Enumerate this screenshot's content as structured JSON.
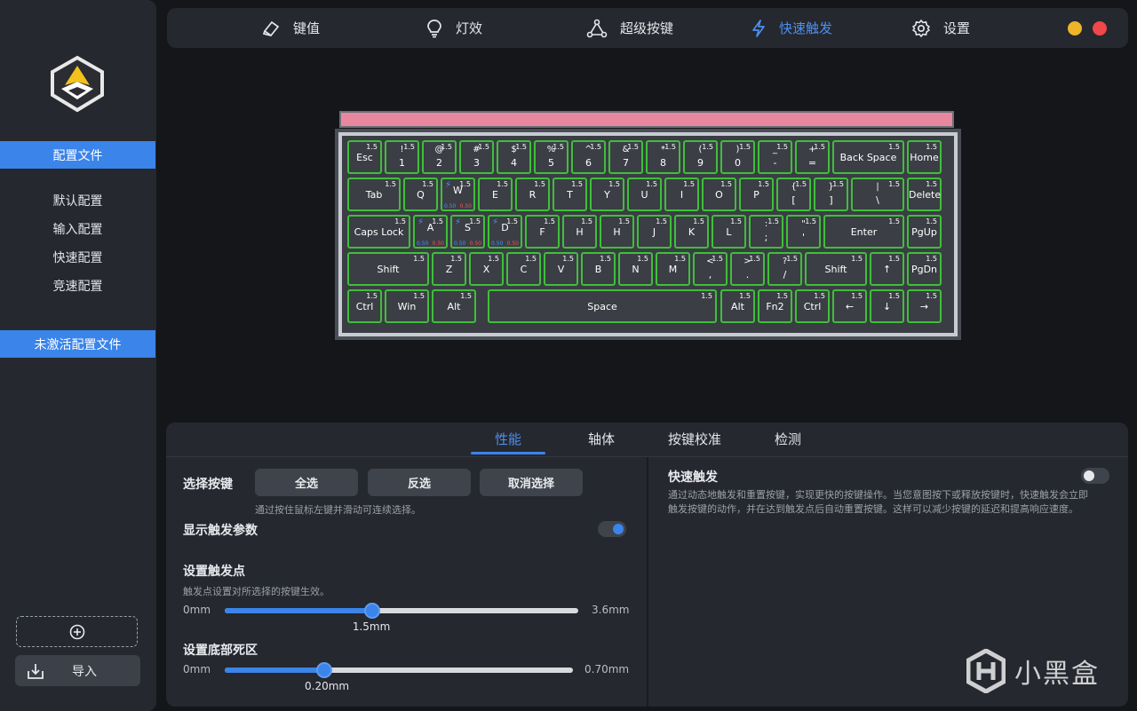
{
  "sidebar": {
    "profiles_header": "配置文件",
    "profiles": [
      "默认配置",
      "输入配置",
      "快速配置",
      "竞速配置"
    ],
    "inactive_header": "未激活配置文件",
    "import_label": "导入"
  },
  "nav": {
    "items": [
      {
        "label": "键值",
        "icon": "key-cap-icon"
      },
      {
        "label": "灯效",
        "icon": "lightbulb-icon"
      },
      {
        "label": "超级按键",
        "icon": "nodes-icon"
      },
      {
        "label": "快速触发",
        "icon": "lightning-icon",
        "active": true
      },
      {
        "label": "设置",
        "icon": "gear-icon"
      }
    ],
    "window_buttons": {
      "minimize_color": "#f0b429",
      "close_color": "#f0474a"
    }
  },
  "keyboard": {
    "strip_color": "#e8889f",
    "key_border_color": "#3fbf3a",
    "rows": [
      [
        {
          "lines": [
            "Esc"
          ],
          "t": "1.5"
        },
        {
          "lines": [
            "!",
            "1"
          ],
          "t": "1.5"
        },
        {
          "lines": [
            "@",
            "2"
          ],
          "t": "1.5"
        },
        {
          "lines": [
            "#",
            "3"
          ],
          "t": "1.5"
        },
        {
          "lines": [
            "$",
            "4"
          ],
          "t": "1.5"
        },
        {
          "lines": [
            "%",
            "5"
          ],
          "t": "1.5"
        },
        {
          "lines": [
            "^",
            "6"
          ],
          "t": "1.5"
        },
        {
          "lines": [
            "&",
            "7"
          ],
          "t": "1.5"
        },
        {
          "lines": [
            "*",
            "8"
          ],
          "t": "1.5"
        },
        {
          "lines": [
            "(",
            "9"
          ],
          "t": "1.5"
        },
        {
          "lines": [
            ")",
            "0"
          ],
          "t": "1.5"
        },
        {
          "lines": [
            "_",
            "-"
          ],
          "t": "1.5"
        },
        {
          "lines": [
            "+",
            "="
          ],
          "t": "1.5"
        },
        {
          "lines": [
            "Back Space"
          ],
          "t": "1.5"
        },
        {
          "lines": [
            "Home"
          ],
          "t": "1.5"
        }
      ],
      [
        {
          "lines": [
            "Tab"
          ],
          "t": "1.5"
        },
        {
          "lines": [
            "Q"
          ],
          "t": "1.5"
        },
        {
          "lines": [
            "W"
          ],
          "t": "1.5",
          "rt": true,
          "lo": "0.50",
          "hi": "0.50"
        },
        {
          "lines": [
            "E"
          ],
          "t": "1.5"
        },
        {
          "lines": [
            "R"
          ],
          "t": "1.5"
        },
        {
          "lines": [
            "T"
          ],
          "t": "1.5"
        },
        {
          "lines": [
            "Y"
          ],
          "t": "1.5"
        },
        {
          "lines": [
            "U"
          ],
          "t": "1.5"
        },
        {
          "lines": [
            "I"
          ],
          "t": "1.5"
        },
        {
          "lines": [
            "O"
          ],
          "t": "1.5"
        },
        {
          "lines": [
            "P"
          ],
          "t": "1.5"
        },
        {
          "lines": [
            "{",
            "["
          ],
          "t": "1.5"
        },
        {
          "lines": [
            "}",
            "]"
          ],
          "t": "1.5"
        },
        {
          "lines": [
            "|",
            "\\"
          ],
          "t": "1.5"
        },
        {
          "lines": [
            "Delete"
          ],
          "t": "1.5"
        }
      ],
      [
        {
          "lines": [
            "Caps Lock"
          ],
          "t": "1.5"
        },
        {
          "lines": [
            "A"
          ],
          "t": "1.5",
          "rt": true,
          "lo": "0.50",
          "hi": "0.50"
        },
        {
          "lines": [
            "S"
          ],
          "t": "1.5",
          "rt": true,
          "lo": "0.50",
          "hi": "0.50"
        },
        {
          "lines": [
            "D"
          ],
          "t": "1.5",
          "rt": true,
          "lo": "0.50",
          "hi": "0.50"
        },
        {
          "lines": [
            "F"
          ],
          "t": "1.5"
        },
        {
          "lines": [
            "H"
          ],
          "t": "1.5"
        },
        {
          "lines": [
            "H"
          ],
          "t": "1.5"
        },
        {
          "lines": [
            "J"
          ],
          "t": "1.5"
        },
        {
          "lines": [
            "K"
          ],
          "t": "1.5"
        },
        {
          "lines": [
            "L"
          ],
          "t": "1.5"
        },
        {
          "lines": [
            ":",
            ";"
          ],
          "t": "1.5"
        },
        {
          "lines": [
            "\"",
            "'"
          ],
          "t": "1.5"
        },
        {
          "lines": [
            "Enter"
          ],
          "t": "1.5"
        },
        {
          "lines": [
            "PgUp"
          ],
          "t": "1.5"
        }
      ],
      [
        {
          "lines": [
            "Shift"
          ],
          "t": "1.5"
        },
        {
          "lines": [
            "Z"
          ],
          "t": "1.5"
        },
        {
          "lines": [
            "X"
          ],
          "t": "1.5"
        },
        {
          "lines": [
            "C"
          ],
          "t": "1.5"
        },
        {
          "lines": [
            "V"
          ],
          "t": "1.5"
        },
        {
          "lines": [
            "B"
          ],
          "t": "1.5"
        },
        {
          "lines": [
            "N"
          ],
          "t": "1.5"
        },
        {
          "lines": [
            "M"
          ],
          "t": "1.5"
        },
        {
          "lines": [
            "<",
            ","
          ],
          "t": "1.5"
        },
        {
          "lines": [
            ">",
            "."
          ],
          "t": "1.5"
        },
        {
          "lines": [
            "?",
            "/"
          ],
          "t": "1.5"
        },
        {
          "lines": [
            "Shift"
          ],
          "t": "1.5"
        },
        {
          "lines": [
            "↑"
          ],
          "t": "1.5"
        },
        {
          "lines": [
            "PgDn"
          ],
          "t": "1.5"
        }
      ],
      [
        {
          "lines": [
            "Ctrl"
          ],
          "t": "1.5"
        },
        {
          "lines": [
            "Win"
          ],
          "t": "1.5"
        },
        {
          "lines": [
            "Alt"
          ],
          "t": "1.5"
        },
        {
          "lines": [
            "Space"
          ],
          "t": "1.5"
        },
        {
          "lines": [
            "Alt"
          ],
          "t": "1.5"
        },
        {
          "lines": [
            "Fn2"
          ],
          "t": "1.5"
        },
        {
          "lines": [
            "Ctrl"
          ],
          "t": "1.5"
        },
        {
          "lines": [
            "←"
          ],
          "t": "1.5"
        },
        {
          "lines": [
            "↓"
          ],
          "t": "1.5"
        },
        {
          "lines": [
            "→"
          ],
          "t": "1.5"
        }
      ]
    ]
  },
  "panel": {
    "tabs": [
      {
        "label": "性能",
        "active": true
      },
      {
        "label": "轴体"
      },
      {
        "label": "按键校准"
      },
      {
        "label": "检测"
      }
    ],
    "select_keys": {
      "label": "选择按键",
      "buttons": [
        "全选",
        "反选",
        "取消选择"
      ],
      "hint": "通过按住鼠标左键并滑动可连续选择。"
    },
    "show_params": {
      "label": "显示触发参数",
      "enabled": true
    },
    "actuation": {
      "title": "设置触发点",
      "desc": "触发点设置对所选择的按键生效。",
      "min_label": "0mm",
      "max_label": "3.6mm",
      "value_label": "1.5mm",
      "value": 1.5,
      "min": 0,
      "max": 3.6
    },
    "deadzone": {
      "title": "设置底部死区",
      "min_label": "0mm",
      "max_label": "0.70mm",
      "value_label": "0.20mm",
      "value": 0.2,
      "min": 0,
      "max": 0.7
    },
    "rapid_trigger": {
      "title": "快速触发",
      "enabled": false,
      "desc_line1": "通过动态地触发和重置按键，实现更快的按键操作。当您意图按下或释放按键时，快速触发会立即",
      "desc_line2": "触发按键的动作，并在达到触发点后自动重置按键。这样可以减少按键的延迟和提高响应速度。"
    }
  },
  "watermark": {
    "text": "小黑盒"
  },
  "colors": {
    "accent": "#3b84e9",
    "background": "#141619",
    "surface": "#25282e"
  }
}
